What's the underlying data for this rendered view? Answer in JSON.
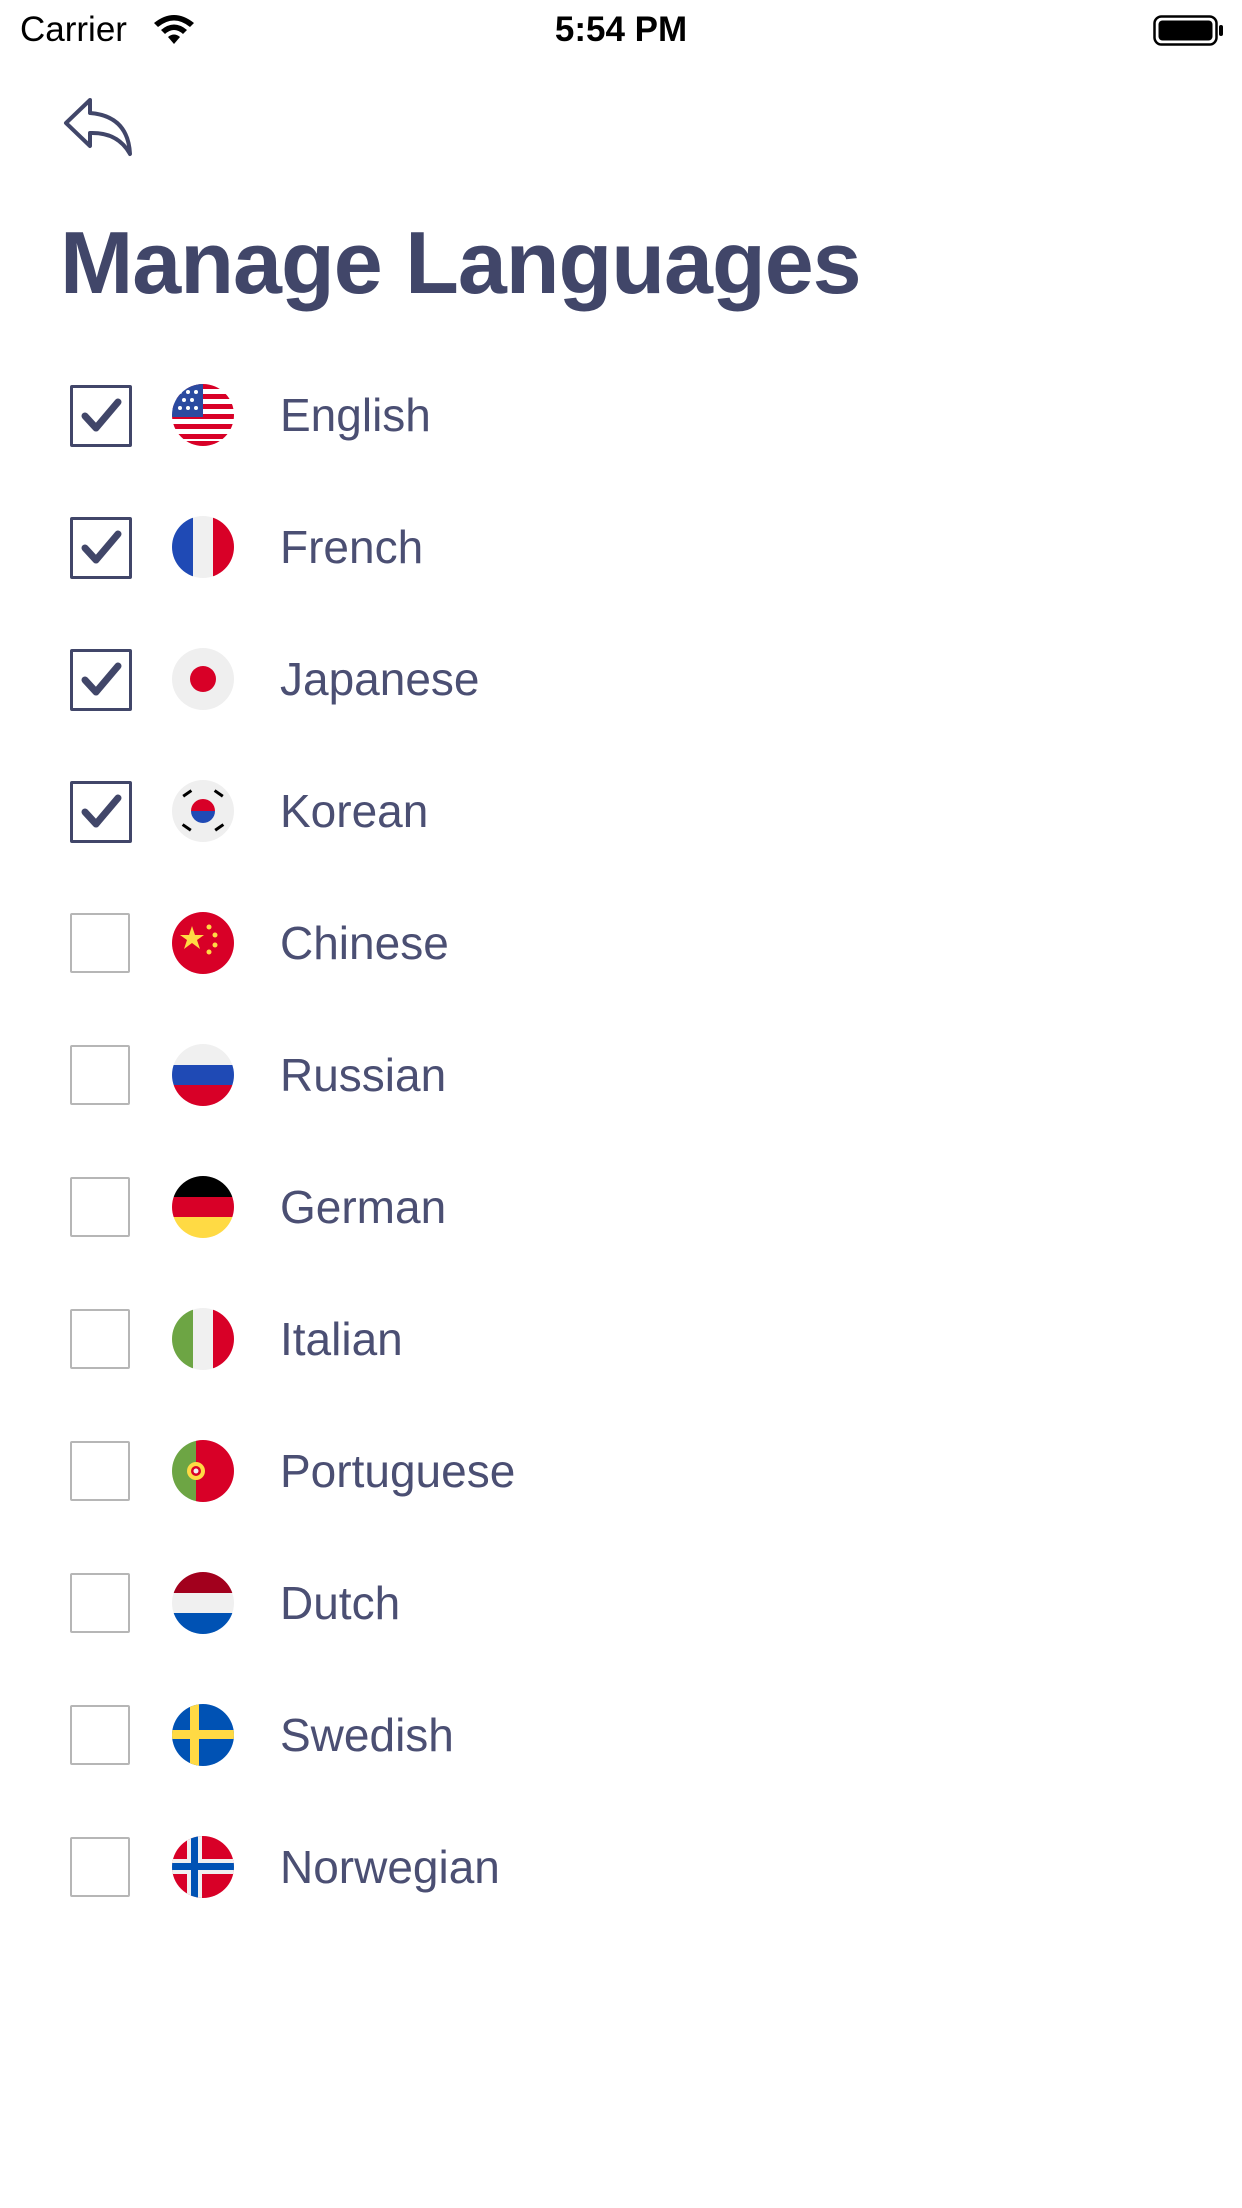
{
  "status_bar": {
    "carrier": "Carrier",
    "time": "5:54 PM"
  },
  "page": {
    "title": "Manage Languages"
  },
  "languages": [
    {
      "label": "English",
      "checked": true,
      "flag_icon": "us-flag-icon"
    },
    {
      "label": "French",
      "checked": true,
      "flag_icon": "france-flag-icon"
    },
    {
      "label": "Japanese",
      "checked": true,
      "flag_icon": "japan-flag-icon"
    },
    {
      "label": "Korean",
      "checked": true,
      "flag_icon": "korea-flag-icon"
    },
    {
      "label": "Chinese",
      "checked": false,
      "flag_icon": "china-flag-icon"
    },
    {
      "label": "Russian",
      "checked": false,
      "flag_icon": "russia-flag-icon"
    },
    {
      "label": "German",
      "checked": false,
      "flag_icon": "germany-flag-icon"
    },
    {
      "label": "Italian",
      "checked": false,
      "flag_icon": "italy-flag-icon"
    },
    {
      "label": "Portuguese",
      "checked": false,
      "flag_icon": "portugal-flag-icon"
    },
    {
      "label": "Dutch",
      "checked": false,
      "flag_icon": "netherlands-flag-icon"
    },
    {
      "label": "Swedish",
      "checked": false,
      "flag_icon": "sweden-flag-icon"
    },
    {
      "label": "Norwegian",
      "checked": false,
      "flag_icon": "norway-flag-icon"
    }
  ],
  "colors": {
    "accent": "#414669",
    "text": "#4b4f73",
    "checkbox_border": "#b6b6b6"
  }
}
